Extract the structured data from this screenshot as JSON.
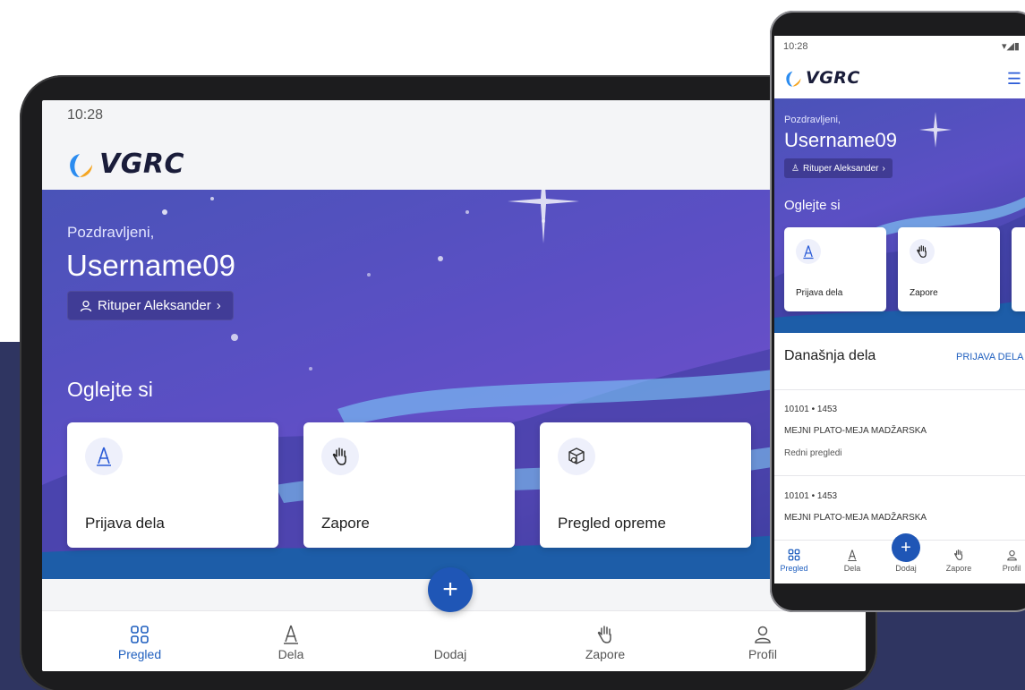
{
  "colors": {
    "brand_blue": "#1f56b6",
    "hero_purple": "#5b4fc4",
    "background_navy": "#2f3561"
  },
  "tablet": {
    "status_time": "10:28",
    "logo_text": "VGRC",
    "greeting": "Pozdravljeni,",
    "username": "Username09",
    "account_chip": "Rituper Aleksander",
    "section_title": "Oglejte si",
    "cards": [
      {
        "label": "Prijava dela",
        "icon": "pen-nib-icon"
      },
      {
        "label": "Zapore",
        "icon": "hand-stop-icon"
      },
      {
        "label": "Pregled opreme",
        "icon": "box-search-icon"
      }
    ],
    "nav": [
      {
        "label": "Pregled",
        "icon": "grid-icon",
        "active": true
      },
      {
        "label": "Dela",
        "icon": "pen-nib-icon"
      },
      {
        "label": "Dodaj",
        "icon": "plus-icon"
      },
      {
        "label": "Zapore",
        "icon": "hand-stop-icon"
      },
      {
        "label": "Profil",
        "icon": "user-icon"
      }
    ]
  },
  "phone": {
    "status_time": "10:28",
    "logo_text": "VGRC",
    "greeting": "Pozdravljeni,",
    "username": "Username09",
    "account_chip": "Rituper Aleksander",
    "section_title": "Oglejte si",
    "cards": [
      {
        "label": "Prijava dela",
        "icon": "pen-nib-icon"
      },
      {
        "label": "Zapore",
        "icon": "hand-stop-icon"
      }
    ],
    "today_title": "Današnja dela",
    "today_link": "PRIJAVA DELA",
    "jobs": [
      {
        "code": "10101 • 1453",
        "place": "MEJNI PLATO-MEJA MADŽARSKA",
        "type": "Redni pregledi"
      },
      {
        "code": "10101 • 1453",
        "place": "MEJNI PLATO-MEJA MADŽARSKA",
        "type": ""
      }
    ],
    "nav": [
      {
        "label": "Pregled",
        "icon": "grid-icon",
        "active": true
      },
      {
        "label": "Dela",
        "icon": "pen-nib-icon"
      },
      {
        "label": "Dodaj",
        "icon": "plus-icon"
      },
      {
        "label": "Zapore",
        "icon": "hand-stop-icon"
      },
      {
        "label": "Profil",
        "icon": "user-icon"
      }
    ]
  }
}
